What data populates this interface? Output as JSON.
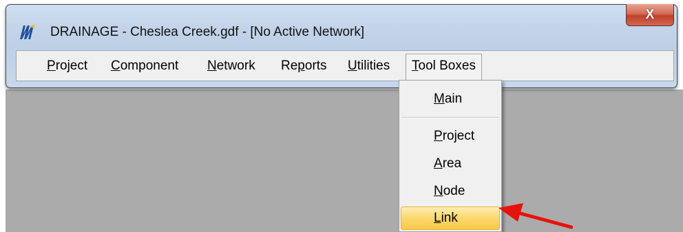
{
  "window": {
    "title": "DRAINAGE - Cheslea Creek.gdf - [No Active Network]",
    "close_glyph": "X",
    "icon": "drainage-app-icon"
  },
  "menubar": {
    "items": [
      {
        "label": "Project",
        "mnemonic": "P",
        "rest": "roject"
      },
      {
        "label": "Component",
        "mnemonic": "C",
        "rest": "omponent"
      },
      {
        "label": "Network",
        "mnemonic": "N",
        "rest": "etwork"
      },
      {
        "label": "Reports",
        "pre": "Re",
        "mnemonic": "p",
        "rest": "orts"
      },
      {
        "label": "Utilities",
        "mnemonic": "U",
        "rest": "tilities"
      },
      {
        "label": "Tool Boxes",
        "mnemonic": "T",
        "rest": "ool Boxes"
      }
    ]
  },
  "dropdown": {
    "items": [
      {
        "label": "Main",
        "mnemonic": "M",
        "rest": "ain"
      },
      {
        "label": "Project",
        "mnemonic": "P",
        "rest": "roject"
      },
      {
        "label": "Area",
        "mnemonic": "A",
        "rest": "rea"
      },
      {
        "label": "Node",
        "mnemonic": "N",
        "rest": "ode"
      },
      {
        "label": "Link",
        "mnemonic": "L",
        "rest": "ink"
      }
    ],
    "highlighted": "Link",
    "highlight_color": "#fbd86e"
  },
  "annotation": {
    "arrow_color": "#e8120c",
    "arrow_icon": "red-arrow-icon"
  }
}
